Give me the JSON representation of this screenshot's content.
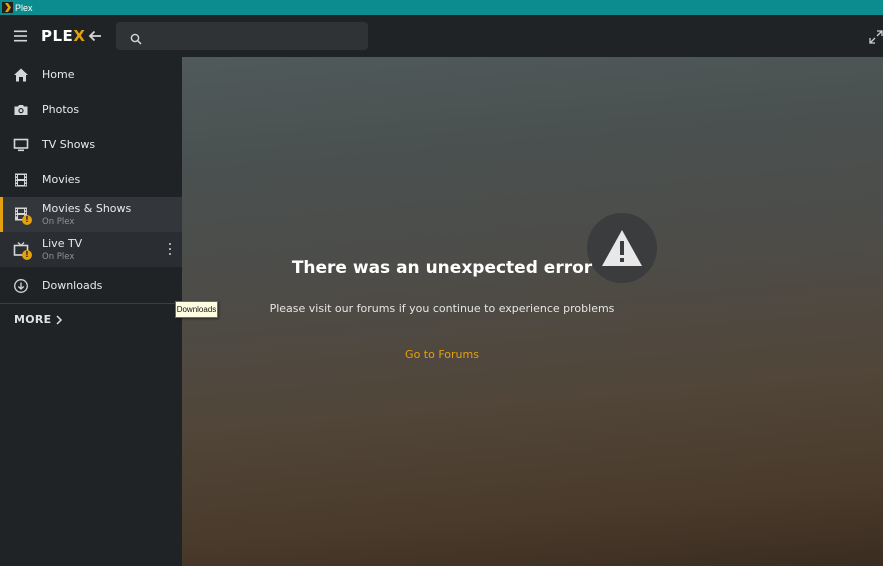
{
  "window": {
    "title": "Plex",
    "icon": "plex-chevron-icon"
  },
  "header": {
    "logo_main": "PLE",
    "logo_accent": "X",
    "search": {
      "value": "",
      "placeholder": ""
    },
    "icons": [
      "hamburger-menu-icon",
      "back-arrow-icon",
      "search-icon",
      "fullscreen-icon"
    ]
  },
  "sidebar": {
    "items": [
      {
        "label": "Home",
        "icon": "home-icon"
      },
      {
        "label": "Photos",
        "icon": "camera-icon"
      },
      {
        "label": "TV Shows",
        "icon": "monitor-icon"
      },
      {
        "label": "Movies",
        "icon": "film-icon"
      },
      {
        "label": "Movies & Shows",
        "sublabel": "On Plex",
        "icon": "film-warning-icon",
        "warning": "!"
      },
      {
        "label": "Live TV",
        "sublabel": "On Plex",
        "icon": "tv-warning-icon",
        "warning": "!"
      },
      {
        "label": "Downloads",
        "icon": "download-icon"
      }
    ],
    "more_label": "MORE"
  },
  "tooltip": {
    "text": "Downloads"
  },
  "main": {
    "error_title": "There was an unexpected error",
    "error_message": "Please visit our forums if you continue to experience problems",
    "forums_link": "Go to Forums",
    "icon": "warning-triangle-icon"
  },
  "colors": {
    "accent": "#e5a00d",
    "titlebar": "#0c8c8f",
    "sidebar_bg": "#1f2326"
  }
}
